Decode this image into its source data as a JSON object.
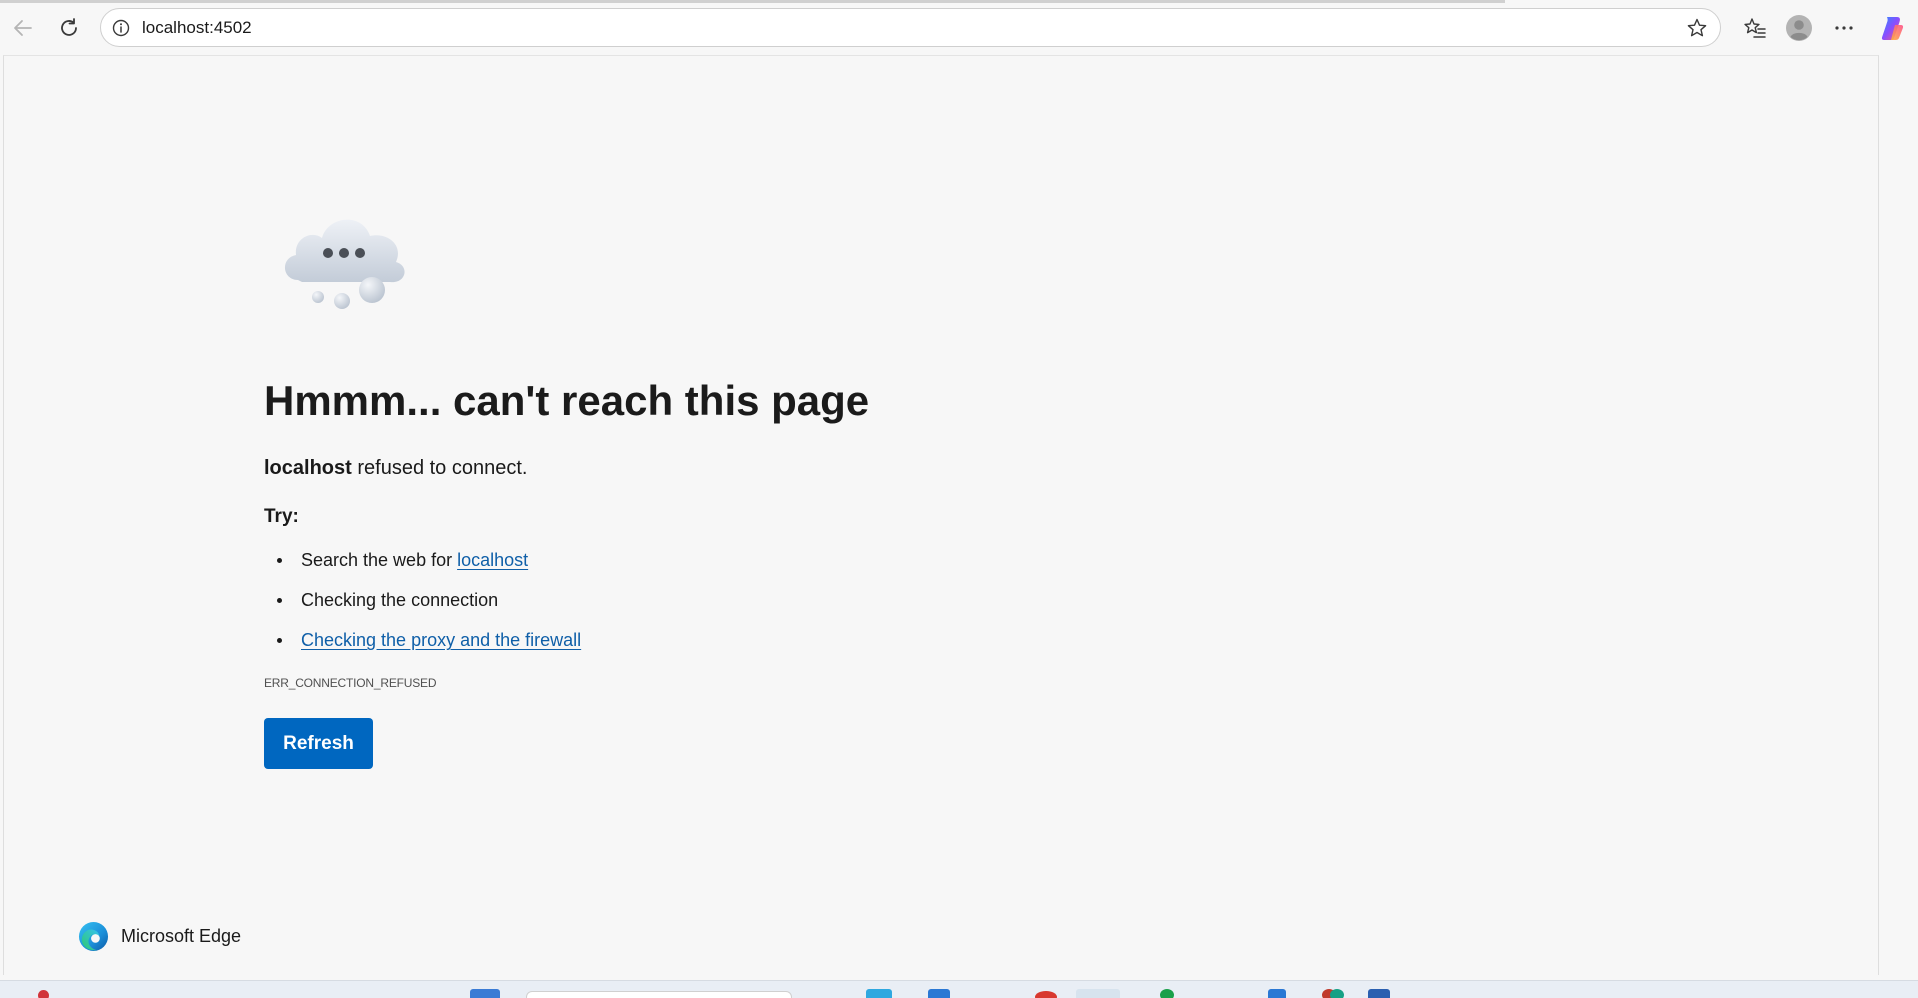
{
  "browser": {
    "url": "localhost:4502",
    "buttons": {
      "back": "back-icon",
      "refresh": "refresh-icon",
      "site_info": "info-icon",
      "favorite": "star-icon",
      "favorites": "favorites-icon",
      "profile": "profile-icon",
      "more": "more-icon",
      "copilot": "copilot-icon"
    }
  },
  "error_page": {
    "heading": "Hmmm... can't reach this page",
    "host": "localhost",
    "message_suffix": " refused to connect.",
    "try_label": "Try:",
    "suggestions": {
      "search_prefix": "Search the web for ",
      "search_link": "localhost",
      "connection": "Checking the connection",
      "proxy_link": "Checking the proxy and the firewall"
    },
    "error_code": "ERR_CONNECTION_REFUSED",
    "refresh_label": "Refresh"
  },
  "footer": {
    "brand": "Microsoft Edge"
  },
  "colors": {
    "accent": "#0067c0",
    "link": "#0f5fa8",
    "background": "#f7f7f7"
  }
}
